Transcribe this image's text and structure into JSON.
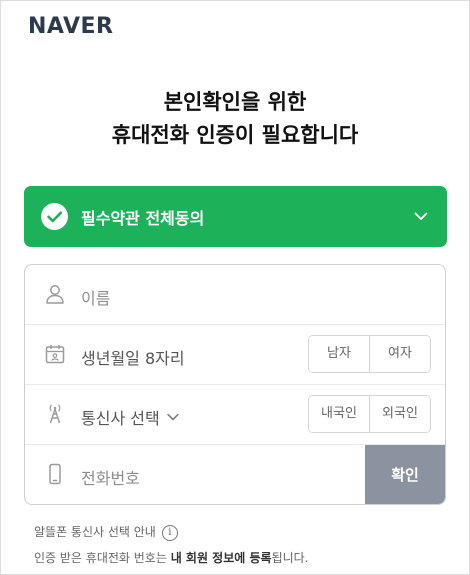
{
  "brand": {
    "logo": "NAVER",
    "accent": "#1db15a"
  },
  "heading": {
    "line1": "본인확인을 위한",
    "line2": "휴대전화 인증이 필요합니다"
  },
  "agreement": {
    "label": "필수약관 전체동의",
    "checked": true,
    "icon_left": "check-circle-icon",
    "icon_right": "chevron-down-icon"
  },
  "form": {
    "name_placeholder": "이름",
    "birth_placeholder": "생년월일 8자리",
    "gender": {
      "male": "남자",
      "female": "여자"
    },
    "carrier_label": "통신사 선택",
    "nationality": {
      "domestic": "내국인",
      "foreign": "외국인"
    },
    "phone_placeholder": "전화번호",
    "confirm_label": "확인",
    "confirm_color": "#8c93a0"
  },
  "notes": {
    "mvno_guide": "알뜰폰 통신사 선택 안내",
    "reg_prefix": "인증 받은 휴대전화 번호는 ",
    "reg_bold": "내 회원 정보에 등록",
    "reg_suffix": "됩니다."
  }
}
